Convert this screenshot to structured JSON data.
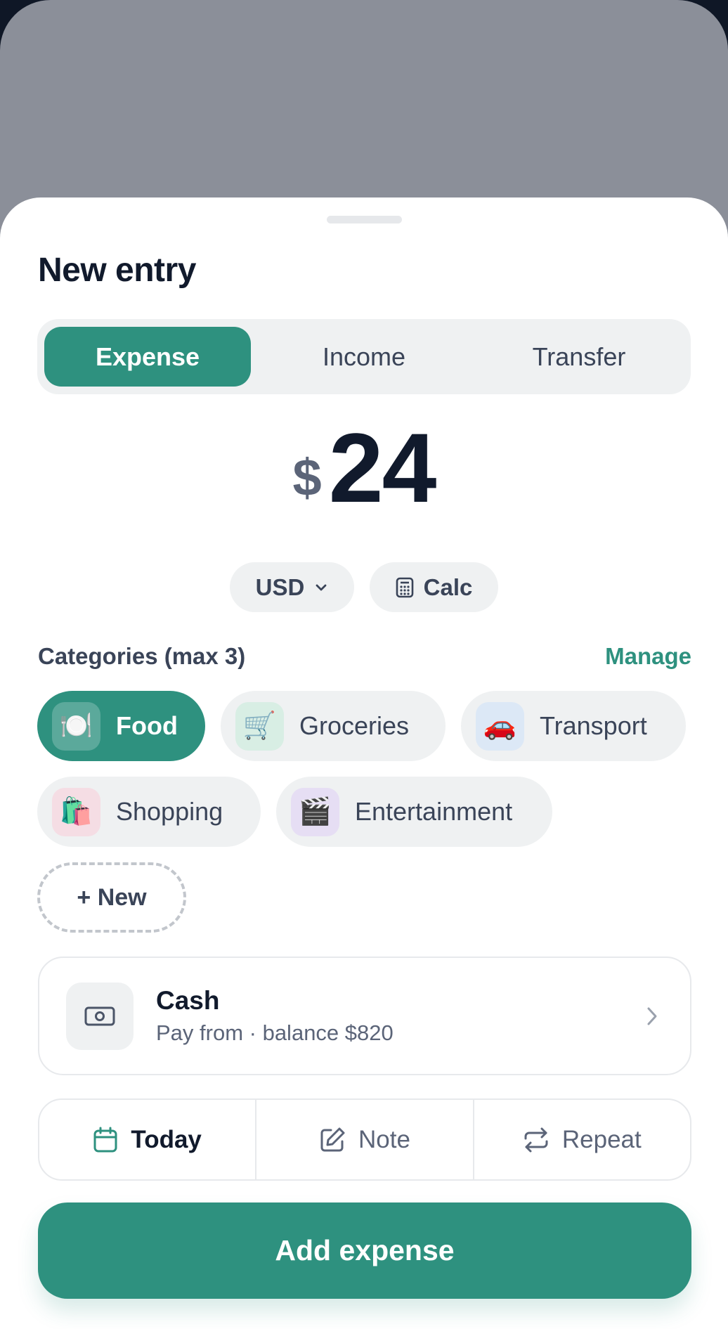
{
  "sheet": {
    "title": "New entry"
  },
  "type_tabs": [
    {
      "label": "Expense",
      "active": true
    },
    {
      "label": "Income",
      "active": false
    },
    {
      "label": "Transfer",
      "active": false
    }
  ],
  "amount": {
    "currency_symbol": "$",
    "value": "24"
  },
  "currency_pill": {
    "label": "USD",
    "icon": "chevron-down-icon"
  },
  "calc_pill": {
    "label": "Calc",
    "icon": "calculator-icon"
  },
  "categories": {
    "header": "Categories (max 3)",
    "manage_label": "Manage",
    "items": [
      {
        "label": "Food",
        "emoji": "🍽️",
        "selected": true
      },
      {
        "label": "Groceries",
        "emoji": "🛒",
        "selected": false
      },
      {
        "label": "Transport",
        "emoji": "🚗",
        "selected": false
      },
      {
        "label": "Shopping",
        "emoji": "🛍️",
        "selected": false
      },
      {
        "label": "Entertainment",
        "emoji": "🎬",
        "selected": false
      }
    ],
    "new_label": "+ New"
  },
  "account": {
    "name": "Cash",
    "subtitle": "Pay from · balance $820",
    "icon": "banknote-icon"
  },
  "actions": [
    {
      "label": "Today",
      "icon": "calendar-icon"
    },
    {
      "label": "Note",
      "icon": "edit-icon"
    },
    {
      "label": "Repeat",
      "icon": "repeat-icon"
    }
  ],
  "cta_label": "Add expense",
  "colors": {
    "accent": "#2e917f",
    "text_dark": "#111a2c",
    "text_muted": "#5b6478",
    "chip_bg": "#eff1f2"
  }
}
